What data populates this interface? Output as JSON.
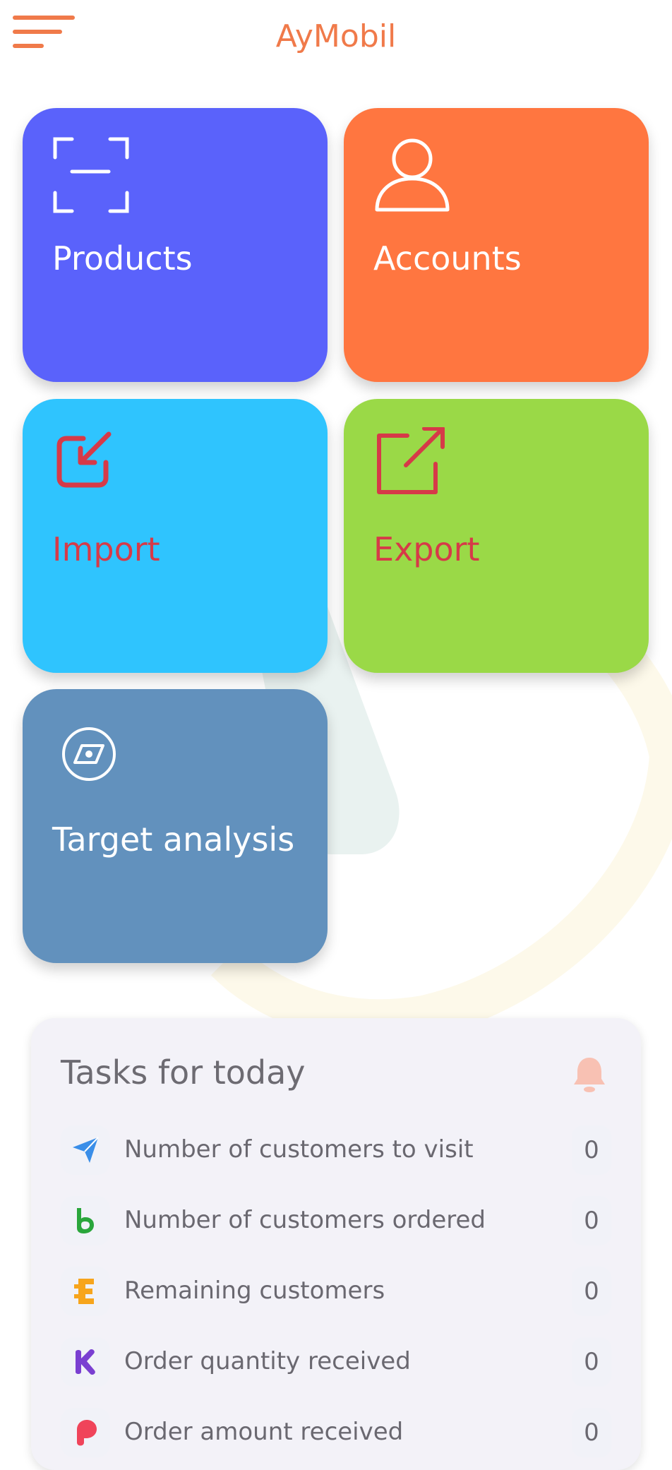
{
  "header": {
    "app_title": "AyMobil",
    "menu_icon": "hamburger-menu-icon"
  },
  "tiles": [
    {
      "key": "products",
      "label": "Products",
      "icon": "scan-icon",
      "color": "#5a62fb"
    },
    {
      "key": "accounts",
      "label": "Accounts",
      "icon": "user-icon",
      "color": "#ff7640"
    },
    {
      "key": "import",
      "label": "Import",
      "icon": "import-icon",
      "color": "#2fc4fe"
    },
    {
      "key": "export",
      "label": "Export",
      "icon": "export-icon",
      "color": "#9ad947"
    },
    {
      "key": "target",
      "label": "Target analysis",
      "icon": "compass-icon",
      "color": "#6291bd"
    }
  ],
  "tasks": {
    "title": "Tasks for today",
    "bell_icon": "bell-icon",
    "items": [
      {
        "label": "Number of customers to visit",
        "value": "0",
        "icon": "send-icon"
      },
      {
        "label": "Number of customers ordered",
        "value": "0",
        "icon": "b-logo-icon"
      },
      {
        "label": "Remaining customers",
        "value": "0",
        "icon": "e-logo-icon"
      },
      {
        "label": "Order quantity received",
        "value": "0",
        "icon": "k-logo-icon"
      },
      {
        "label": "Order amount received",
        "value": "0",
        "icon": "p-logo-icon"
      }
    ]
  },
  "colors": {
    "accent": "#f07a4a",
    "tile_text_red": "#d63a48",
    "card_bg": "#f3f2f8"
  }
}
